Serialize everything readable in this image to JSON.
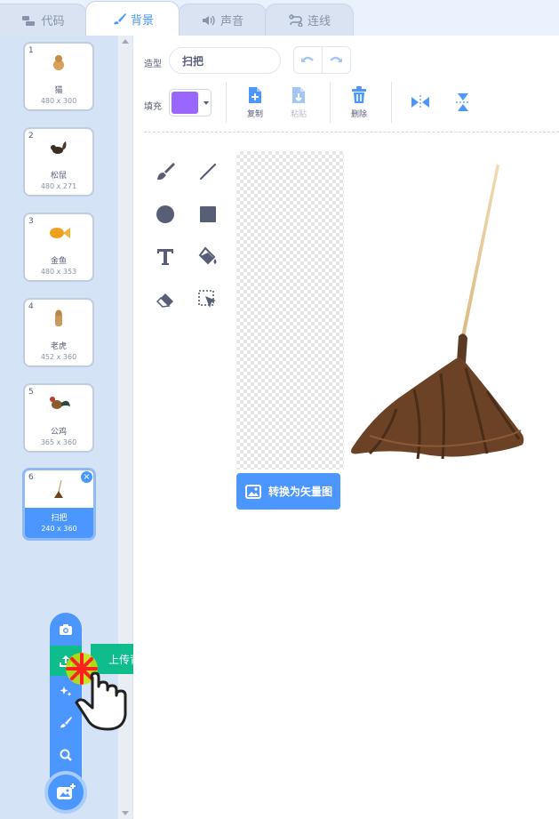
{
  "tabs": [
    {
      "label": "代码",
      "icon": "code-icon"
    },
    {
      "label": "背景",
      "icon": "brush-icon",
      "active": true
    },
    {
      "label": "声音",
      "icon": "speaker-icon"
    },
    {
      "label": "连线",
      "icon": "link-icon"
    }
  ],
  "backdrops": [
    {
      "num": "1",
      "name": "猫",
      "size": "480 x 300"
    },
    {
      "num": "2",
      "name": "松鼠",
      "size": "480 x 271"
    },
    {
      "num": "3",
      "name": "金鱼",
      "size": "480 x 353"
    },
    {
      "num": "4",
      "name": "老虎",
      "size": "452 x 360"
    },
    {
      "num": "5",
      "name": "公鸡",
      "size": "365 x 360"
    },
    {
      "num": "6",
      "name": "扫把",
      "size": "240 x 360",
      "selected": true
    }
  ],
  "backdrop_menu": {
    "tooltip": "上传背景",
    "items": [
      "camera-icon",
      "upload-icon",
      "surprise-icon",
      "paint-icon",
      "search-icon"
    ]
  },
  "editor": {
    "costume_label": "造型",
    "costume_name": "扫把",
    "fill_label": "填充",
    "fill_color": "#9966ff",
    "copy_label": "复制",
    "paste_label": "粘贴",
    "delete_label": "删除",
    "convert_label": "转换为矢量图"
  },
  "colors": {
    "accent": "#4c97ff",
    "tooltip": "#0fbd8c"
  }
}
